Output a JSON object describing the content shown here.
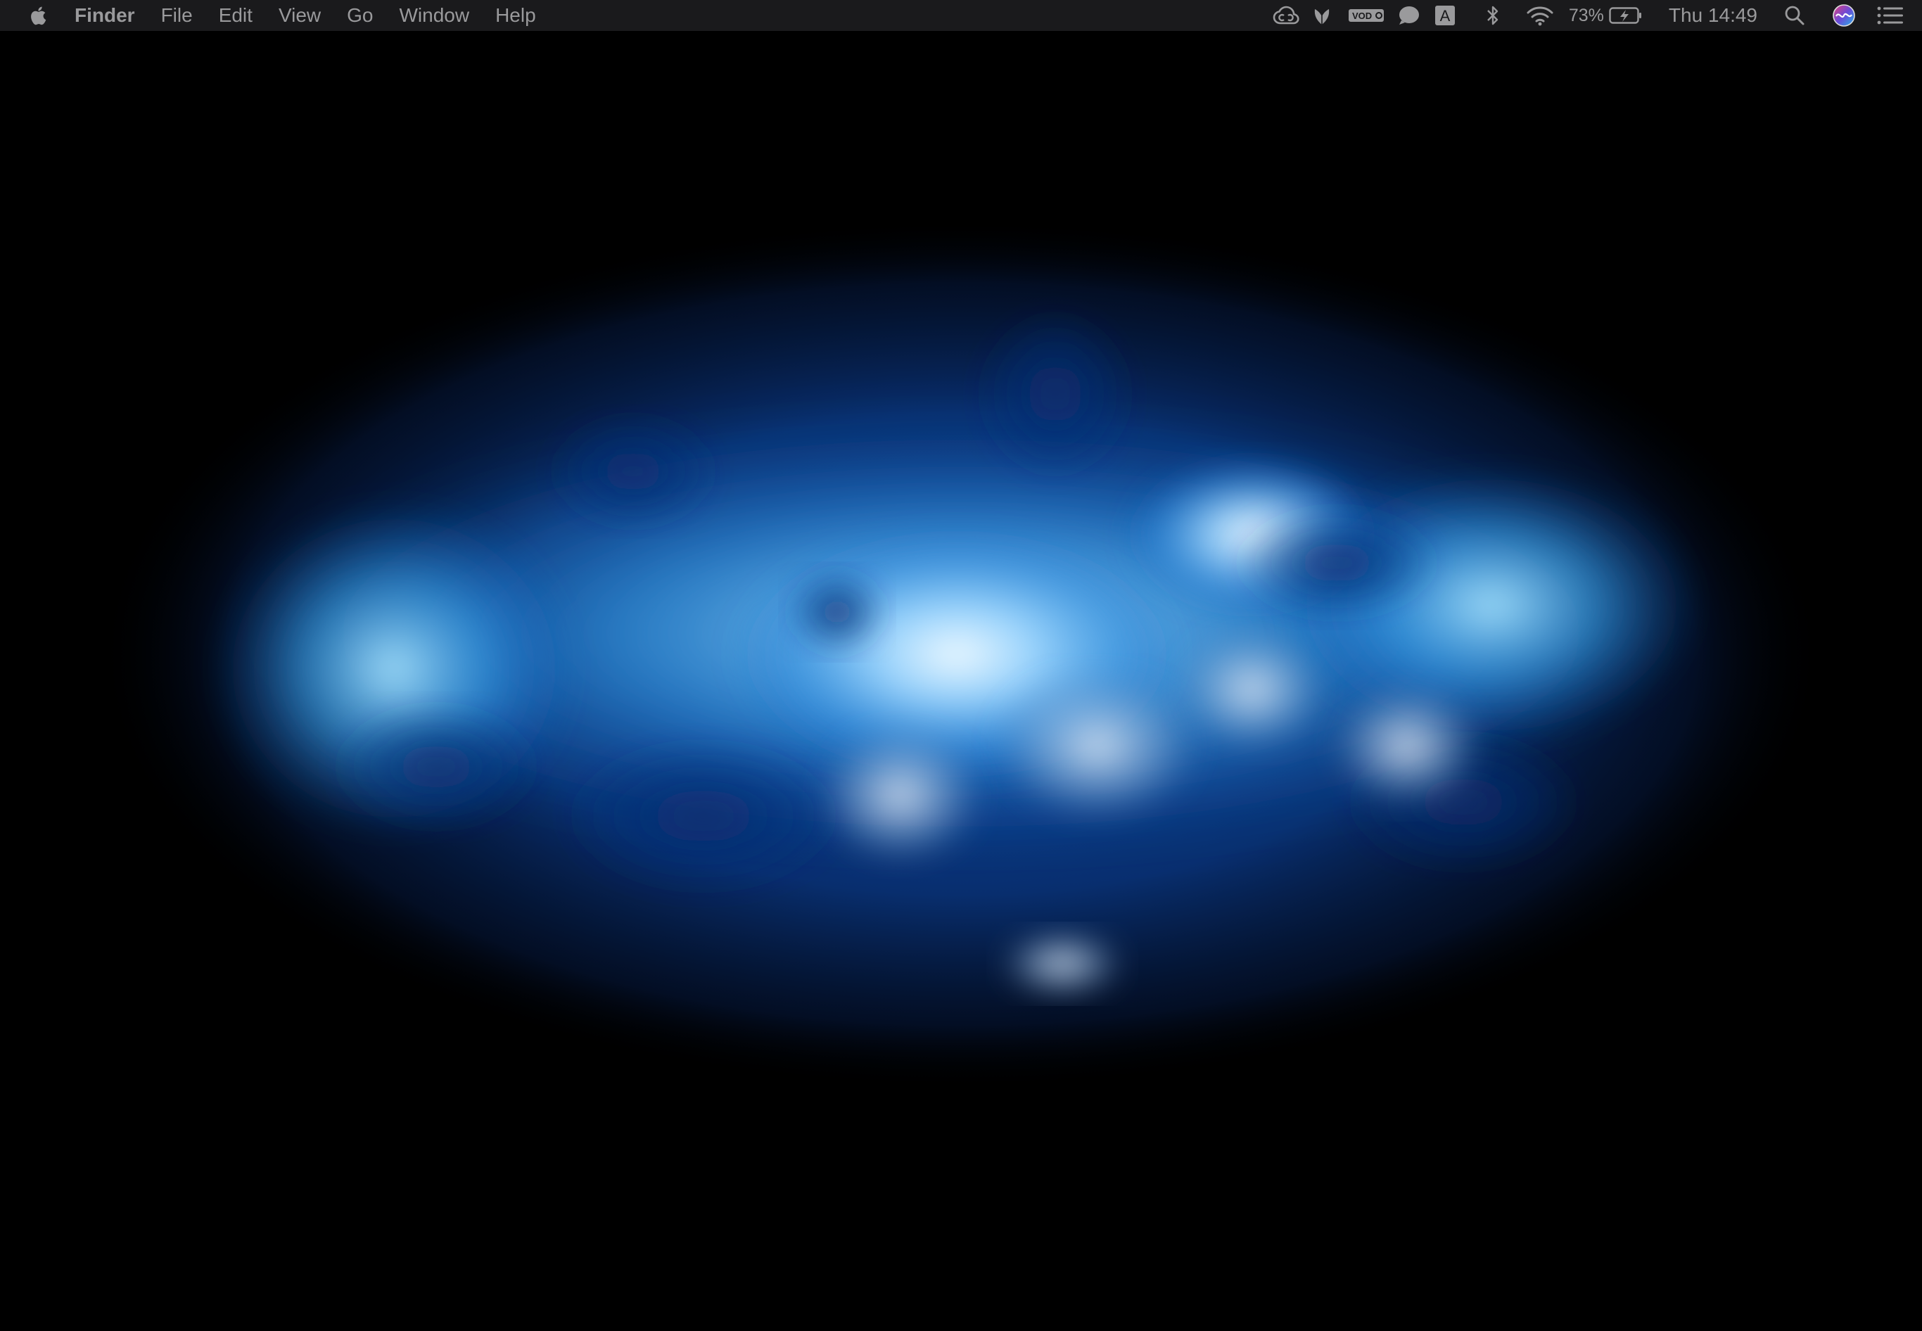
{
  "menubar": {
    "app_name": "Finder",
    "menus": [
      "File",
      "Edit",
      "View",
      "Go",
      "Window",
      "Help"
    ],
    "battery_percent": "73%",
    "clock": "Thu 14:49",
    "keyboard_input_letter": "A",
    "vodafone_label": "VOD"
  },
  "icons": {
    "apple": "apple-icon",
    "creative_cloud": "creative-cloud-icon",
    "leaf": "leaf-icon",
    "vodafone": "vodafone-icon",
    "chat": "chat-bubble-icon",
    "input_source": "input-source-icon",
    "bluetooth": "bluetooth-icon",
    "wifi": "wifi-icon",
    "battery": "battery-charging-icon",
    "spotlight": "search-icon",
    "siri": "siri-icon",
    "notification_center": "notification-center-icon"
  },
  "colors": {
    "menubar_bg": "#1a1a1c",
    "menubar_text": "#9a9a9c",
    "wallpaper_core": "#eaf6ff",
    "wallpaper_mid": "#2f8ee0",
    "wallpaper_edge": "#071a45"
  }
}
